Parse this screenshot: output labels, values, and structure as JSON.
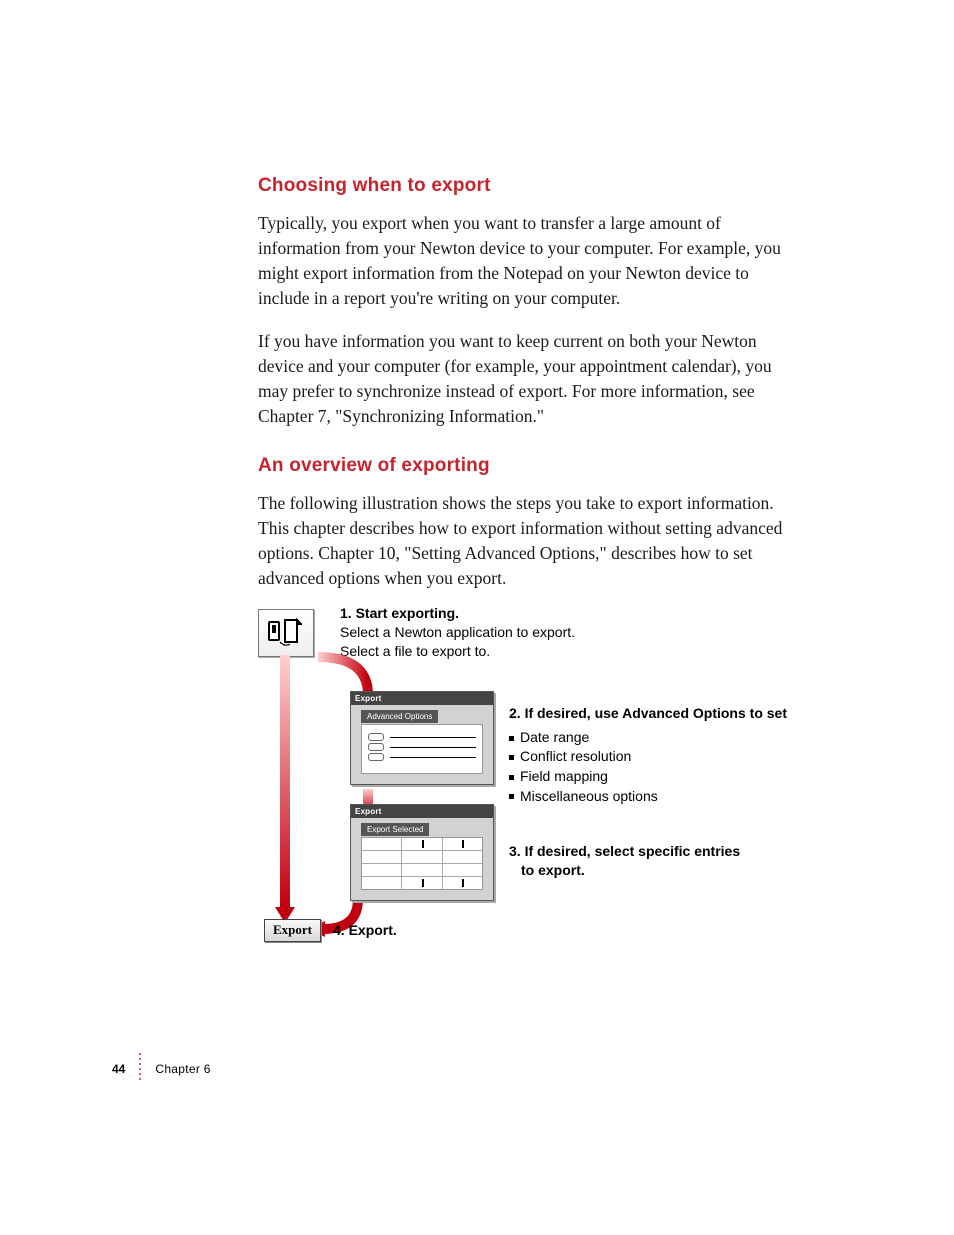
{
  "headings": {
    "h1": "Choosing when to export",
    "h2": "An overview of exporting"
  },
  "paragraphs": {
    "p1": "Typically, you export when you want to transfer a large amount of information from your Newton device to your computer. For example, you might export information from the Notepad on your Newton device to include in a report you're writing on your computer.",
    "p2": "If you have information you want to keep current on both your Newton device and your computer (for example, your appointment calendar), you may prefer to synchronize instead of export. For more information, see Chapter 7, \"Synchronizing Information.\"",
    "p3": "The following illustration shows the steps you take to export information. This chapter describes how to export information without setting advanced options. Chapter 10, \"Setting Advanced Options,\" describes how to set advanced options when you export."
  },
  "illustration": {
    "step1": {
      "title": "1. Start exporting.",
      "line1": "Select a Newton application to export.",
      "line2": "Select a file to export to."
    },
    "dialog1": {
      "title": "Export",
      "tab": "Advanced Options"
    },
    "step2": {
      "title": "2. If desired, use Advanced Options to set",
      "bullets": [
        "Date range",
        "Conflict resolution",
        "Field mapping",
        "Miscellaneous options"
      ]
    },
    "dialog2": {
      "title": "Export",
      "tab": "Export Selected"
    },
    "step3": {
      "title": "3. If desired, select specific entries",
      "line2": "to export."
    },
    "step4": {
      "title": "4. Export.",
      "button": "Export"
    }
  },
  "footer": {
    "page": "44",
    "chapter": "Chapter 6"
  }
}
